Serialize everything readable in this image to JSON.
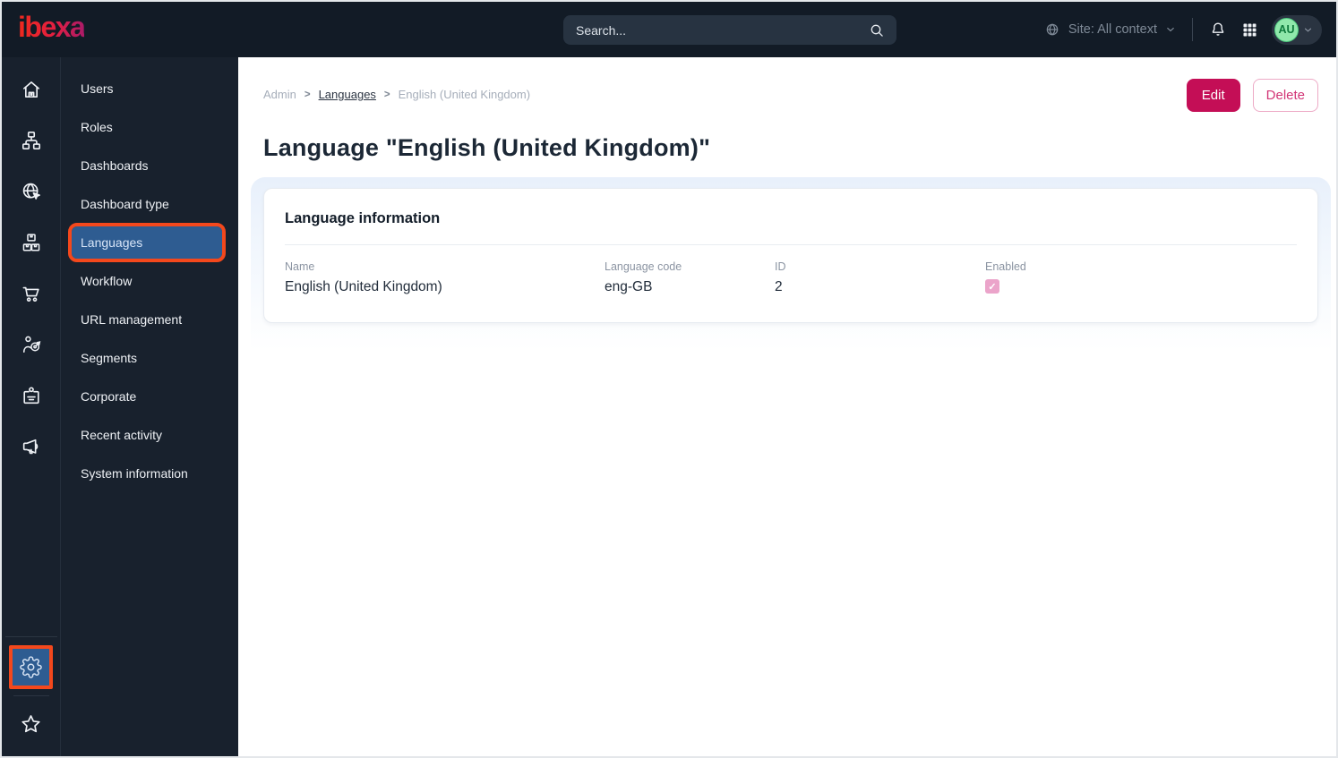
{
  "topbar": {
    "logo_text": "ibexa",
    "search": {
      "placeholder": "Search..."
    },
    "site_context_label": "Site: All context",
    "avatar_initials": "AU"
  },
  "icon_rail": {
    "main_icons": [
      "home",
      "content-tree",
      "site",
      "product-catalog",
      "commerce",
      "personalization",
      "customer-portal",
      "marketing"
    ],
    "bottom_icons": [
      "settings",
      "bookmarks"
    ],
    "active_icon": "settings"
  },
  "sidebar": {
    "items": [
      {
        "label": "Users",
        "active": false
      },
      {
        "label": "Roles",
        "active": false
      },
      {
        "label": "Dashboards",
        "active": false
      },
      {
        "label": "Dashboard type",
        "active": false
      },
      {
        "label": "Languages",
        "active": true,
        "annotated": true
      },
      {
        "label": "Workflow",
        "active": false
      },
      {
        "label": "URL management",
        "active": false
      },
      {
        "label": "Segments",
        "active": false
      },
      {
        "label": "Corporate",
        "active": false
      },
      {
        "label": "Recent activity",
        "active": false
      },
      {
        "label": "System information",
        "active": false
      }
    ]
  },
  "main": {
    "breadcrumb": {
      "items": [
        "Admin",
        "Languages",
        "English (United Kingdom)"
      ],
      "separator": ">"
    },
    "actions": {
      "edit_label": "Edit",
      "delete_label": "Delete"
    },
    "page_title": "Language \"English (United Kingdom)\"",
    "card": {
      "title": "Language information",
      "fields": [
        {
          "label": "Name",
          "value": "English (United Kingdom)"
        },
        {
          "label": "Language code",
          "value": "eng-GB"
        },
        {
          "label": "ID",
          "value": "2"
        },
        {
          "label": "Enabled",
          "checked": true
        }
      ]
    }
  },
  "colors": {
    "topbar_bg": "#121b26",
    "sidebar_bg": "#18212d",
    "brand_accent": "#c40e56",
    "annotation_highlight": "#f4481c",
    "active_item_blue": "#2e5c91",
    "avatar_green": "#90e8ab",
    "checkbox_pink": "#eba4ca"
  }
}
